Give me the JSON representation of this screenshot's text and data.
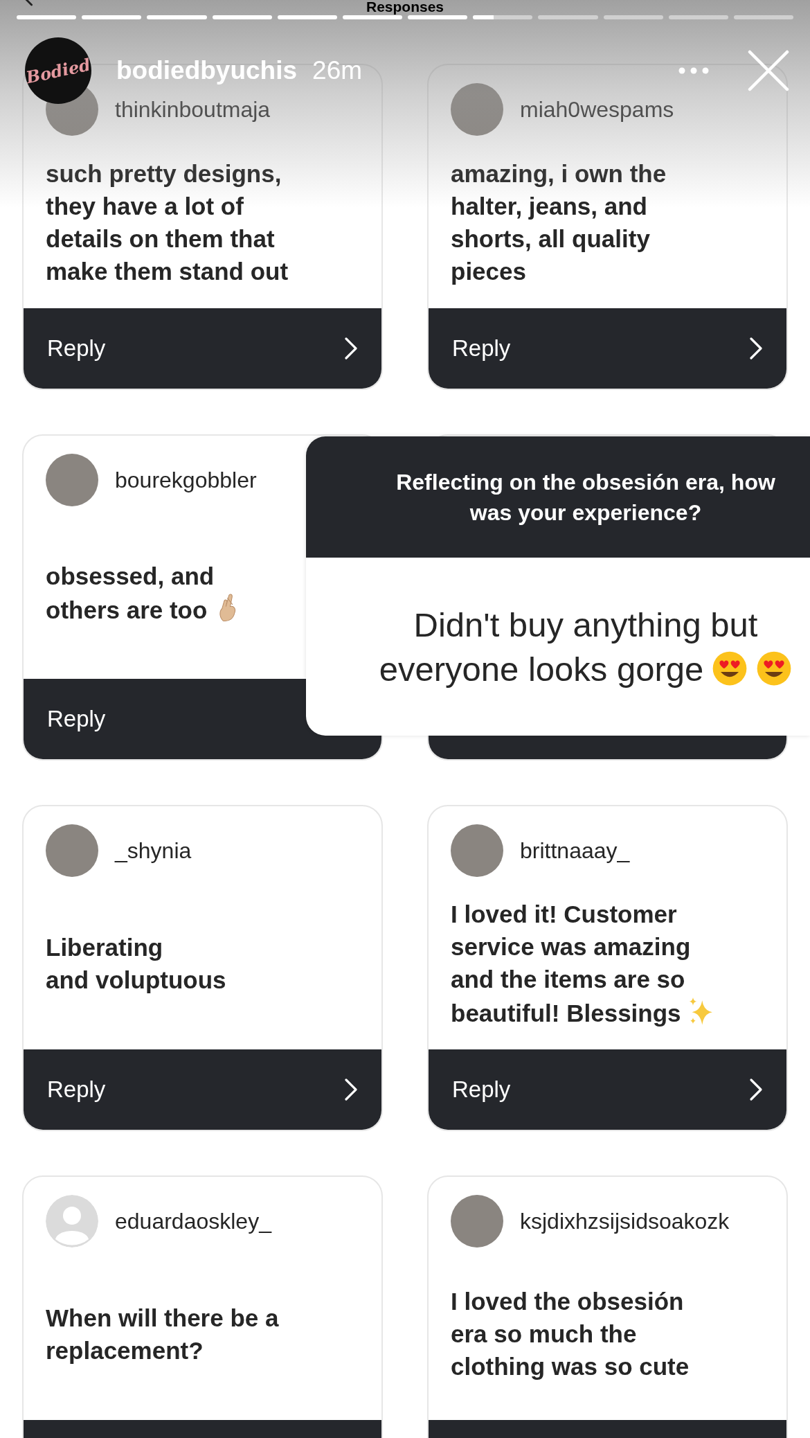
{
  "title": "Responses",
  "progress": [
    {
      "kind": "seen"
    },
    {
      "kind": "seen"
    },
    {
      "kind": "seen"
    },
    {
      "kind": "seen"
    },
    {
      "kind": "seen"
    },
    {
      "kind": "seen"
    },
    {
      "kind": "seen"
    },
    {
      "kind": "current",
      "level": 0.35
    },
    {
      "kind": "unseen"
    },
    {
      "kind": "unseen"
    },
    {
      "kind": "unseen"
    },
    {
      "kind": "unseen"
    }
  ],
  "story": {
    "logo_text": "Bodied",
    "username": "bodiedbyuchis",
    "time": "26m"
  },
  "cards": [
    {
      "kind": "response",
      "username": "thinkinboutmaja",
      "avatar": {
        "kind": "photo"
      },
      "lines": [
        "such pretty designs,",
        "they have a lot of",
        "details on them that",
        "make them stand out"
      ],
      "reply": "Reply",
      "chevron": true
    },
    {
      "kind": "response",
      "username": "miah0wespams",
      "avatar": {
        "kind": "photo"
      },
      "lines": [
        "amazing, i own the",
        "halter, jeans, and",
        "shorts, all quality",
        "pieces"
      ],
      "reply": "Reply",
      "chevron": true
    },
    {
      "kind": "response",
      "username": "bourekgobbler",
      "avatar": {
        "kind": "photo"
      },
      "lines": [
        "obsessed, and",
        "others are too"
      ],
      "emoji": [
        {
          "kind": "crossed-fingers"
        }
      ],
      "reply": "Reply",
      "chevron": false
    },
    {
      "kind": "covered"
    },
    {
      "kind": "response",
      "username": "_shynia",
      "avatar": {
        "kind": "photo"
      },
      "lines": [
        "Liberating",
        "and voluptuous"
      ],
      "reply": "Reply",
      "chevron": true
    },
    {
      "kind": "response",
      "username": "brittnaaay_",
      "avatar": {
        "kind": "photo"
      },
      "lines": [
        "I loved it! Customer",
        "service was amazing",
        "and the items are so",
        "beautiful! Blessings"
      ],
      "emoji": [
        {
          "kind": "sparkles"
        }
      ],
      "reply": "Reply",
      "chevron": true
    },
    {
      "kind": "response",
      "username": "eduardaoskley_",
      "avatar": {
        "kind": "default"
      },
      "lines": [
        "When will there be a",
        "replacement?"
      ],
      "chevron": false
    },
    {
      "kind": "response",
      "username": "ksjdixhzsijsidsoakozk",
      "avatar": {
        "kind": "photo"
      },
      "lines": [
        "I loved the obsesión",
        "era so much the",
        "clothing was so cute"
      ],
      "chevron": false
    }
  ],
  "sticker": {
    "question_lines": [
      "Reflecting on the obsesión era, how",
      "was your experience?"
    ],
    "answer_lines": [
      "Didn't buy anything but",
      "everyone looks gorge"
    ],
    "emoji": [
      {
        "kind": "heart-eyes"
      },
      {
        "kind": "heart-eyes"
      }
    ]
  }
}
